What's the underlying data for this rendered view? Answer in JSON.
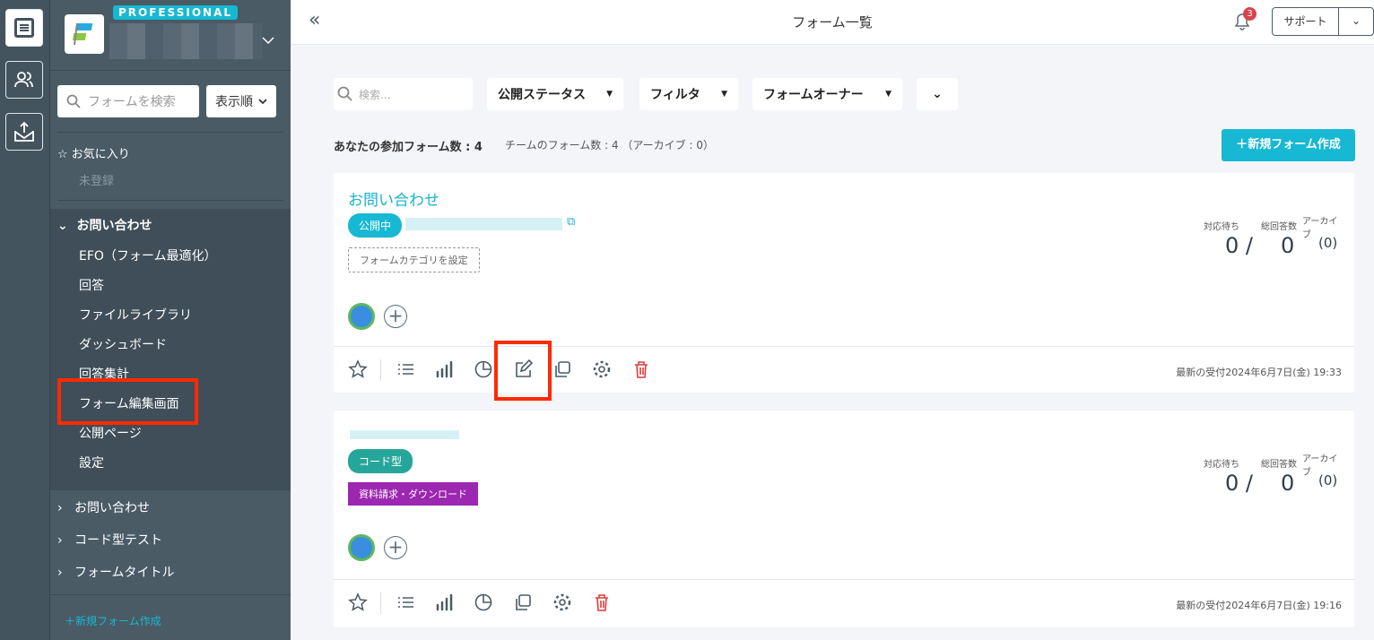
{
  "sidebar": {
    "plan_badge": "PROFESSIONAL",
    "search_placeholder": "フォームを検索",
    "sort_label": "表示順",
    "favorites_label": "お気に入り",
    "favorites_empty": "未登録",
    "expanded_group": {
      "label": "お問い合わせ",
      "items": [
        "EFO（フォーム最適化）",
        "回答",
        "ファイルライブラリ",
        "ダッシュボード",
        "回答集計",
        "フォーム編集画面",
        "公開ページ",
        "設定"
      ]
    },
    "collapsed_groups": [
      "お問い合わせ",
      "コード型テスト",
      "フォームタイトル"
    ],
    "new_form_label": "新規フォーム作成"
  },
  "header": {
    "title": "フォーム一覧",
    "notification_count": "3",
    "support_label": "サポート"
  },
  "filters": {
    "search_placeholder": "検索...",
    "status_label": "公開ステータス",
    "filter_label": "フィルタ",
    "owner_label": "フォームオーナー"
  },
  "summary": {
    "my_forms": "あなたの参加フォーム数 : 4",
    "team_forms": "チームのフォーム数 : 4 （アーカイブ : 0）",
    "new_form_button": "新規フォーム作成"
  },
  "stat_labels": {
    "pending": "対応待ち",
    "total": "総回答数",
    "archive": "アーカイブ"
  },
  "forms": [
    {
      "title": "お問い合わせ",
      "status": "公開中",
      "category": "フォームカテゴリを設定",
      "pending": "0 /",
      "total": "0",
      "archive": "(0)",
      "latest": "最新の受付2024年6月7日(金) 19:33"
    },
    {
      "status": "コード型",
      "category": "資料請求・ダウンロード",
      "pending": "0 /",
      "total": "0",
      "archive": "(0)",
      "latest": "最新の受付2024年6月7日(金) 19:16"
    }
  ],
  "colors": {
    "accent": "#17b8d3",
    "highlight": "#ff2a00",
    "code_badge": "#26a69a",
    "category_badge": "#9c27b0"
  }
}
